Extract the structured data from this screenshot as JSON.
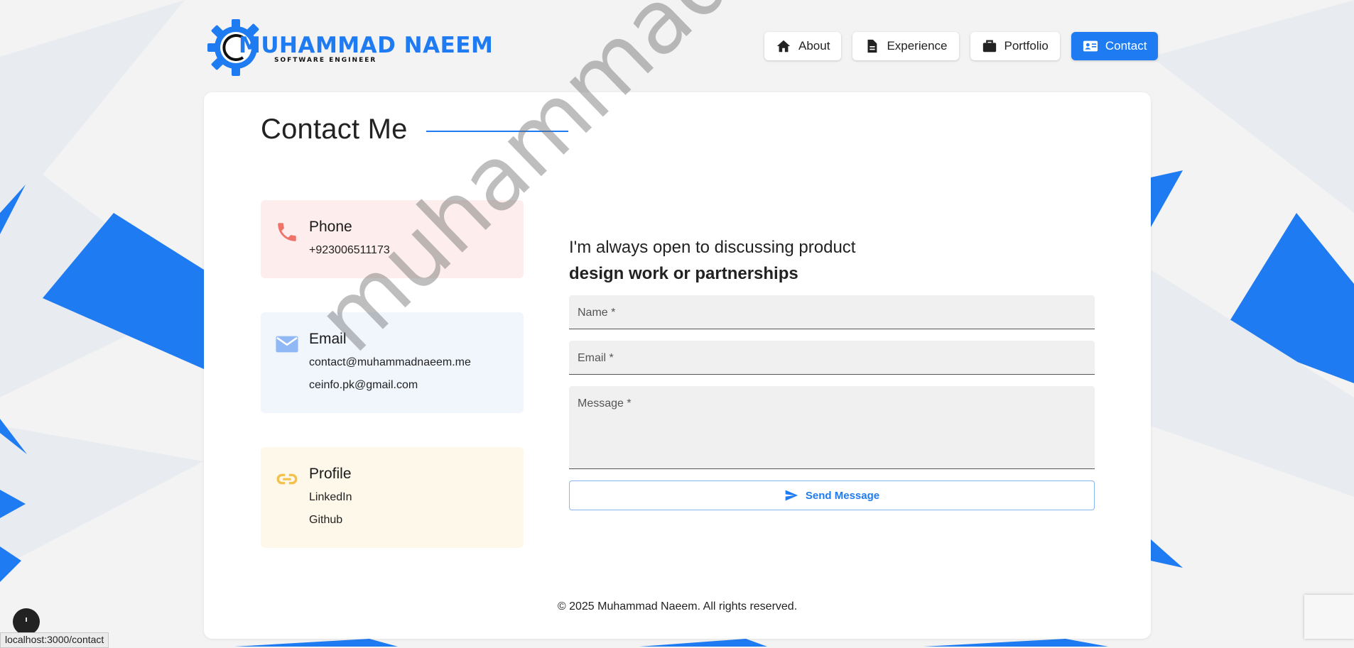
{
  "logo": {
    "name": "MUHAMMAD NAEEM",
    "subtitle": "SOFTWARE ENGINEER"
  },
  "nav": {
    "items": [
      {
        "label": "About",
        "icon": "home-icon"
      },
      {
        "label": "Experience",
        "icon": "document-icon"
      },
      {
        "label": "Portfolio",
        "icon": "briefcase-icon"
      },
      {
        "label": "Contact",
        "icon": "contact-card-icon",
        "active": true
      }
    ]
  },
  "page": {
    "title": "Contact Me"
  },
  "contact": {
    "phone": {
      "heading": "Phone",
      "value": "+923006511173",
      "icon": "phone-icon",
      "color": "#f0736a"
    },
    "email": {
      "heading": "Email",
      "values": [
        "contact@muhammadnaeem.me",
        "ceinfo.pk@gmail.com"
      ],
      "icon": "mail-icon",
      "color": "#8fb8f5"
    },
    "profile": {
      "heading": "Profile",
      "links": [
        "LinkedIn",
        "Github"
      ],
      "icon": "link-icon",
      "color": "#f3c14c"
    }
  },
  "form": {
    "tagline_line1": "I'm always open to discussing product",
    "tagline_line2": "design work or partnerships",
    "name_label": "Name *",
    "email_label": "Email *",
    "message_label": "Message *",
    "send_label": "Send Message"
  },
  "footer": {
    "text": "© 2025 Muhammad Naeem. All rights reserved."
  },
  "watermark": {
    "text": "muhammadnaeem.me"
  },
  "status_bar": {
    "url": "localhost:3000/contact"
  },
  "colors": {
    "accent": "#1f7bf2",
    "background": "#f3f3f3"
  }
}
